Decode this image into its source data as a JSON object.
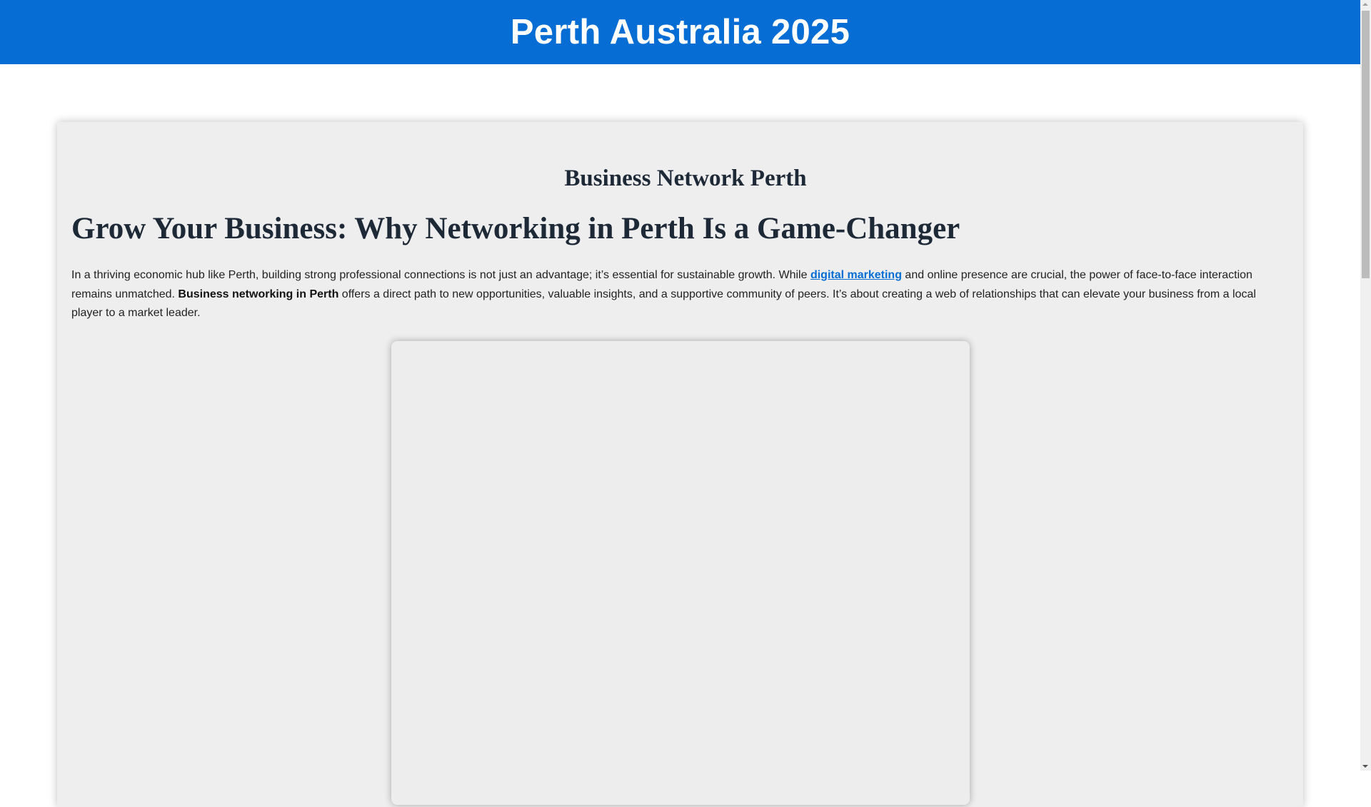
{
  "header": {
    "title": "Perth Australia 2025"
  },
  "article": {
    "site_title": "Business Network Perth",
    "heading": "Grow Your Business: Why Networking in Perth Is a Game-Changer",
    "paragraph": {
      "part1": "In a thriving economic hub like Perth, building strong professional connections is not just an advantage; it’s essential for sustainable growth. While ",
      "link": "digital marketing",
      "part2": " and online presence are crucial, the power of face-to-face interaction remains unmatched. ",
      "bold": "Business networking in Perth",
      "part3": " offers a direct path to new opportunities, valuable insights, and a supportive community of peers. It’s about creating a web of relationships that can elevate your business from a local player to a market leader."
    }
  },
  "colors": {
    "brand": "#056dd4",
    "card_bg": "#eeeeee",
    "heading": "#1e2938"
  }
}
